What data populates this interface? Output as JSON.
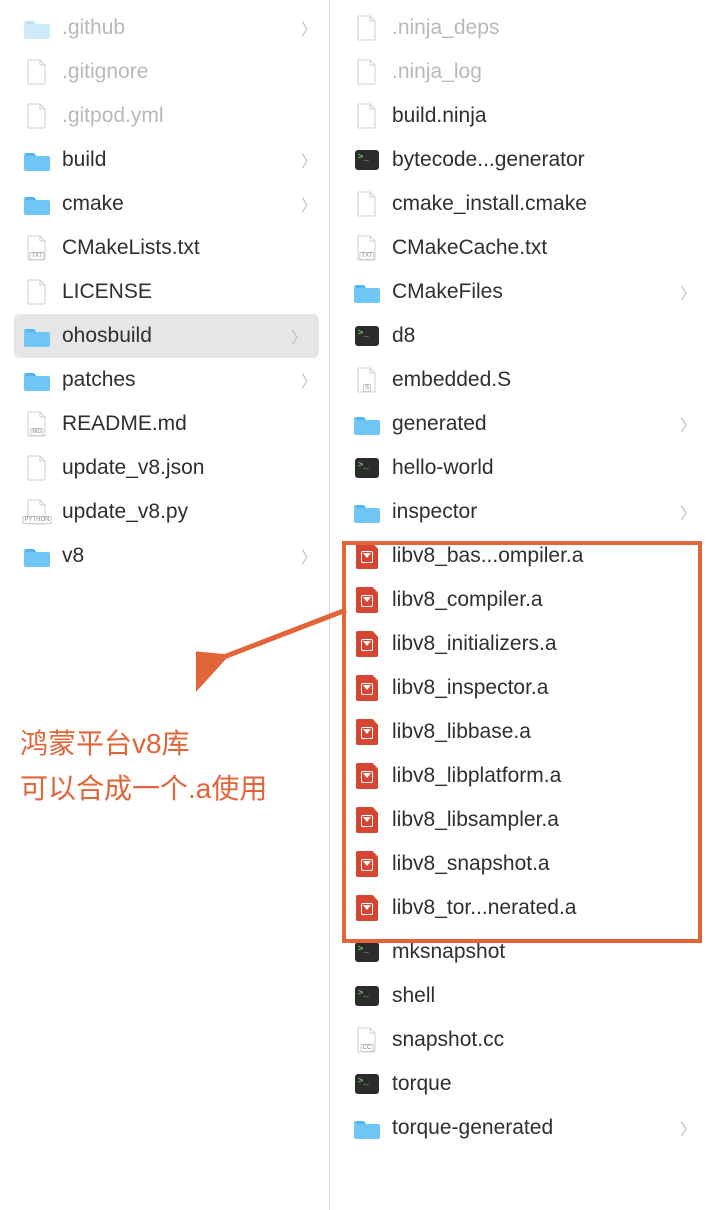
{
  "annotation": {
    "line1": "鸿蒙平台v8库",
    "line2": "可以合成一个.a使用"
  },
  "left_column": [
    {
      "name": ".github",
      "type": "folder",
      "dim": true,
      "chevron": true
    },
    {
      "name": ".gitignore",
      "type": "file",
      "dim": true,
      "chevron": false
    },
    {
      "name": ".gitpod.yml",
      "type": "yml",
      "dim": true,
      "chevron": false
    },
    {
      "name": "build",
      "type": "folder",
      "dim": false,
      "chevron": true
    },
    {
      "name": "cmake",
      "type": "folder",
      "dim": false,
      "chevron": true
    },
    {
      "name": "CMakeLists.txt",
      "type": "txt",
      "dim": false,
      "chevron": false
    },
    {
      "name": "LICENSE",
      "type": "file",
      "dim": false,
      "chevron": false
    },
    {
      "name": "ohosbuild",
      "type": "folder",
      "dim": false,
      "chevron": true,
      "selected": true
    },
    {
      "name": "patches",
      "type": "folder",
      "dim": false,
      "chevron": true
    },
    {
      "name": "README.md",
      "type": "md",
      "dim": false,
      "chevron": false
    },
    {
      "name": "update_v8.json",
      "type": "file",
      "dim": false,
      "chevron": false
    },
    {
      "name": "update_v8.py",
      "type": "py",
      "dim": false,
      "chevron": false
    },
    {
      "name": "v8",
      "type": "folder",
      "dim": false,
      "chevron": true
    }
  ],
  "right_column": [
    {
      "name": ".ninja_deps",
      "type": "file",
      "dim": true,
      "chevron": false
    },
    {
      "name": ".ninja_log",
      "type": "file",
      "dim": true,
      "chevron": false
    },
    {
      "name": "build.ninja",
      "type": "file",
      "dim": false,
      "chevron": false
    },
    {
      "name": "bytecode...generator",
      "type": "exec",
      "dim": false,
      "chevron": false
    },
    {
      "name": "cmake_install.cmake",
      "type": "file",
      "dim": false,
      "chevron": false
    },
    {
      "name": "CMakeCache.txt",
      "type": "txt",
      "dim": false,
      "chevron": false
    },
    {
      "name": "CMakeFiles",
      "type": "folder",
      "dim": false,
      "chevron": true
    },
    {
      "name": "d8",
      "type": "exec",
      "dim": false,
      "chevron": false
    },
    {
      "name": "embedded.S",
      "type": "s",
      "dim": false,
      "chevron": false
    },
    {
      "name": "generated",
      "type": "folder",
      "dim": false,
      "chevron": true
    },
    {
      "name": "hello-world",
      "type": "exec",
      "dim": false,
      "chevron": false
    },
    {
      "name": "inspector",
      "type": "folder",
      "dim": false,
      "chevron": true
    },
    {
      "name": "libv8_bas...ompiler.a",
      "type": "archive",
      "dim": false,
      "chevron": false
    },
    {
      "name": "libv8_compiler.a",
      "type": "archive",
      "dim": false,
      "chevron": false
    },
    {
      "name": "libv8_initializers.a",
      "type": "archive",
      "dim": false,
      "chevron": false
    },
    {
      "name": "libv8_inspector.a",
      "type": "archive",
      "dim": false,
      "chevron": false
    },
    {
      "name": "libv8_libbase.a",
      "type": "archive",
      "dim": false,
      "chevron": false
    },
    {
      "name": "libv8_libplatform.a",
      "type": "archive",
      "dim": false,
      "chevron": false
    },
    {
      "name": "libv8_libsampler.a",
      "type": "archive",
      "dim": false,
      "chevron": false
    },
    {
      "name": "libv8_snapshot.a",
      "type": "archive",
      "dim": false,
      "chevron": false
    },
    {
      "name": "libv8_tor...nerated.a",
      "type": "archive",
      "dim": false,
      "chevron": false
    },
    {
      "name": "mksnapshot",
      "type": "exec",
      "dim": false,
      "chevron": false
    },
    {
      "name": "shell",
      "type": "exec",
      "dim": false,
      "chevron": false
    },
    {
      "name": "snapshot.cc",
      "type": "cc",
      "dim": false,
      "chevron": false
    },
    {
      "name": "torque",
      "type": "exec",
      "dim": false,
      "chevron": false
    },
    {
      "name": "torque-generated",
      "type": "folder",
      "dim": false,
      "chevron": true
    }
  ]
}
